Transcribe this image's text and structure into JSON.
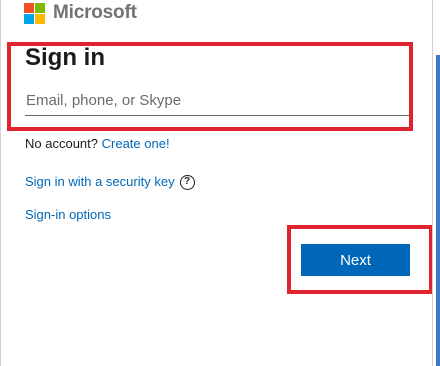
{
  "brand": {
    "name": "Microsoft",
    "logo_colors": [
      "#f25022",
      "#7fba00",
      "#00a4ef",
      "#ffb900"
    ]
  },
  "signin": {
    "title": "Sign in",
    "email_placeholder": "Email, phone, or Skype",
    "email_value": ""
  },
  "links": {
    "no_account_text": "No account?",
    "create_one": "Create one!",
    "security_key": "Sign in with a security key",
    "help_icon_glyph": "?",
    "signin_options": "Sign-in options"
  },
  "actions": {
    "next_label": "Next"
  },
  "colors": {
    "accent": "#0067b8",
    "highlight": "#e0242f",
    "text": "#1b1b1b"
  }
}
